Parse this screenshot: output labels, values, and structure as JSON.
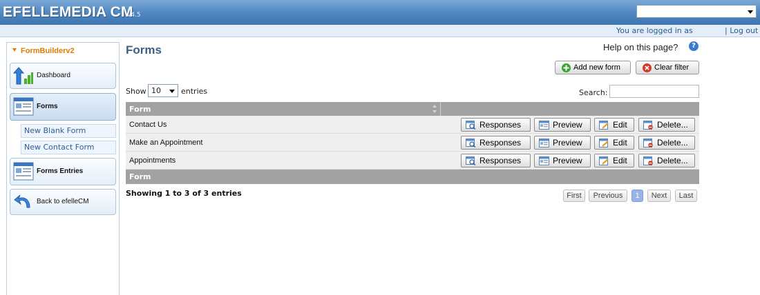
{
  "header": {
    "app_title": "EFELLEMEDIA CM",
    "version": "v4.5",
    "site_select_value": "",
    "logged_in_text": "You are logged in as",
    "logout_label": "| Log out"
  },
  "sidebar": {
    "module_title": "FormBuilderv2",
    "items": [
      {
        "label": "Dashboard",
        "icon": "dashboard-icon"
      },
      {
        "label": "Forms",
        "icon": "forms-icon"
      },
      {
        "label": "Forms Entries",
        "icon": "forms-entries-icon"
      },
      {
        "label": "Back to efelleCM",
        "icon": "back-arrow-icon"
      }
    ],
    "sub_items": [
      {
        "label": "New Blank Form"
      },
      {
        "label": "New Contact Form"
      }
    ]
  },
  "main": {
    "title": "Forms",
    "help_label": "Help on this page?",
    "add_form_label": "Add new form",
    "clear_filter_label": "Clear filter",
    "show_label": "Show",
    "entries_value": "10",
    "entries_label": "entries",
    "search_label": "Search:",
    "search_value": "",
    "table": {
      "header": "Form",
      "footer": "Form",
      "rows": [
        {
          "name": "Contact Us"
        },
        {
          "name": "Make an Appointment"
        },
        {
          "name": "Appointments"
        }
      ],
      "actions": [
        "Responses",
        "Preview",
        "Edit",
        "Delete..."
      ]
    },
    "info_text": "Showing 1 to 3 of 3 entries",
    "pagination": {
      "first": "First",
      "previous": "Previous",
      "current": "1",
      "next": "Next",
      "last": "Last"
    }
  },
  "colors": {
    "header_blue": "#4f86bf",
    "title_blue": "#3c5f83",
    "sidebar_orange": "#e07b00",
    "table_header_gray": "#a2a2a2",
    "add_green": "#3aa52e",
    "clear_red": "#d43a2a"
  }
}
